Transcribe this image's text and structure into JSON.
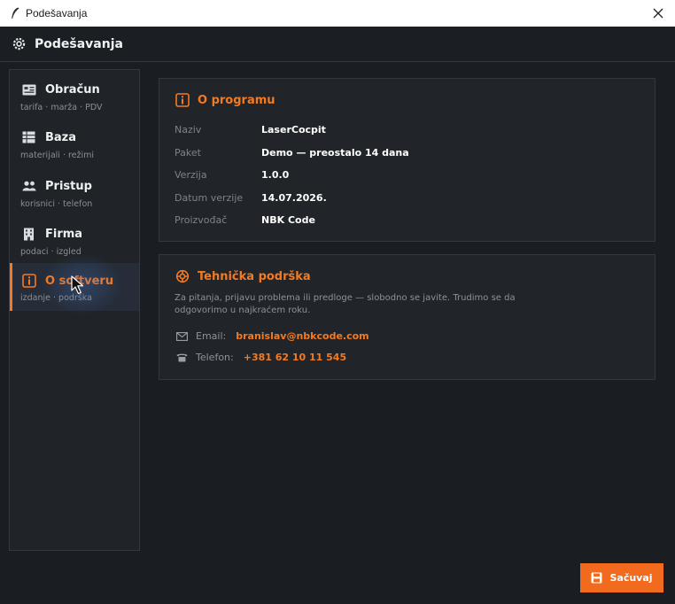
{
  "window": {
    "title": "Podešavanja"
  },
  "header": {
    "title": "Podešavanja"
  },
  "sidebar": {
    "items": [
      {
        "label": "Obračun",
        "subtitle": "tarifa · marža · PDV",
        "icon": "calculator-icon"
      },
      {
        "label": "Baza",
        "subtitle": "materijali · režimi",
        "icon": "database-icon"
      },
      {
        "label": "Pristup",
        "subtitle": "korisnici · telefon",
        "icon": "users-icon"
      },
      {
        "label": "Firma",
        "subtitle": "podaci · izgled",
        "icon": "building-icon"
      },
      {
        "label": "O softveru",
        "subtitle": "izdanje · podrška",
        "icon": "info-icon",
        "active": true
      }
    ]
  },
  "about": {
    "title": "O programu",
    "rows": [
      {
        "key": "Naziv",
        "value": "LaserCocpit"
      },
      {
        "key": "Paket",
        "value": "Demo — preostalo 14 dana"
      },
      {
        "key": "Verzija",
        "value": "1.0.0"
      },
      {
        "key": "Datum verzije",
        "value": "14.07.2026."
      },
      {
        "key": "Proizvođač",
        "value": "NBK Code"
      }
    ]
  },
  "support": {
    "title": "Tehnička podrška",
    "text": "Za pitanja, prijavu problema ili predloge — slobodno se javite. Trudimo se da odgovorimo u najkraćem roku.",
    "email_label": "Email:",
    "email": "branislav@nbkcode.com",
    "phone_label": "Telefon:",
    "phone": "+381 62 10 11 545"
  },
  "actions": {
    "save_label": "Sačuvaj"
  },
  "colors": {
    "accent": "#f47a22",
    "button": "#f26a1e",
    "background": "#1a1d21",
    "panel": "#212529"
  }
}
